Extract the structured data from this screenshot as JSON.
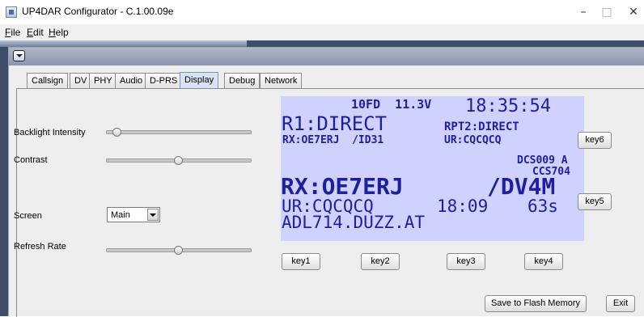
{
  "window": {
    "title": "UP4DAR Configurator - C.1.00.09e",
    "minimize": "–",
    "maximize": "□",
    "close": "✕"
  },
  "menu": {
    "file": "File",
    "edit": "Edit",
    "help": "Help"
  },
  "tabs": [
    {
      "label": "Callsign"
    },
    {
      "label": "DV"
    },
    {
      "label": "PHY"
    },
    {
      "label": "Audio"
    },
    {
      "label": "D-PRS"
    },
    {
      "label": "Display",
      "selected": true
    },
    {
      "label": "Debug"
    },
    {
      "label": "Network"
    }
  ],
  "display": {
    "backlight_label": "Backlight Intensity",
    "backlight_level": 0.05,
    "contrast_label": "Contrast",
    "contrast_level": 0.5,
    "screen_label": "Screen",
    "screen_value": "Main",
    "refresh_label": "Refresh Rate",
    "refresh_level": 0.5,
    "lcd": {
      "status": "10FD  11.3V",
      "time": "18:35:54",
      "line_r1": "R1:DIRECT",
      "line_rpt2": "RPT2:DIRECT",
      "line_rx_small": "RX:OE7ERJ  /ID31",
      "line_ur_small": "UR:CQCQCQ",
      "dcs_line": "DCS009 A",
      "ccs_line": "CCS704",
      "rx_big": "RX:OE7ERJ",
      "suffix_big": "/DV4M",
      "ur_line": "UR:CQCQCQ",
      "ur_time": "18:09",
      "ur_duration": "63s",
      "host_line": "ADL714.DUZZ.AT",
      "bg_color": "#cfd1ff",
      "fg_color": "#1f1f9e"
    },
    "keys": {
      "key1": "key1",
      "key2": "key2",
      "key3": "key3",
      "key4": "key4",
      "key5": "key5",
      "key6": "key6"
    },
    "save_button": "Save to Flash Memory",
    "exit_button": "Exit"
  }
}
